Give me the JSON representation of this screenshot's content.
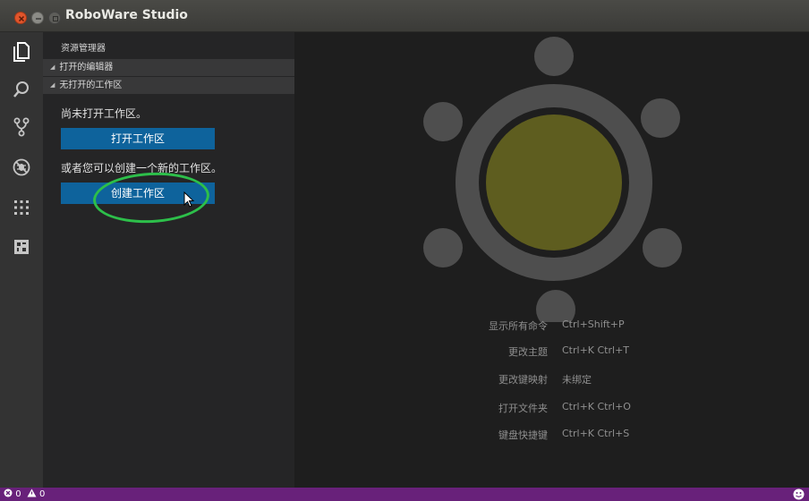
{
  "window": {
    "title": "RoboWare Studio"
  },
  "sidebar": {
    "header": "资源管理器",
    "sections": [
      {
        "label": "打开的编辑器"
      },
      {
        "label": "无打开的工作区"
      }
    ],
    "no_workspace_text": "尚未打开工作区。",
    "open_workspace_label": "打开工作区",
    "or_create_text": "或者您可以创建一个新的工作区。",
    "create_workspace_label": "创建工作区"
  },
  "shortcuts": [
    {
      "label": "显示所有命令",
      "keys": "Ctrl+Shift+P"
    },
    {
      "label": "更改主题",
      "keys": "Ctrl+K Ctrl+T"
    },
    {
      "label": "更改键映射",
      "keys": "未绑定"
    },
    {
      "label": "打开文件夹",
      "keys": "Ctrl+K Ctrl+O"
    },
    {
      "label": "键盘快捷键",
      "keys": "Ctrl+K Ctrl+S"
    }
  ],
  "statusbar": {
    "errors": "0",
    "warnings": "0"
  },
  "colors": {
    "accent_button": "#0e639c",
    "statusbar": "#68217a",
    "highlight_ring": "#2dbf4a",
    "logo_center": "#5e5d1f",
    "logo_gear": "#4e4e4e"
  },
  "icons": {
    "activity": [
      "files-icon",
      "search-icon",
      "source-control-icon",
      "debug-icon",
      "extensions-grid-icon",
      "ros-icon"
    ]
  }
}
